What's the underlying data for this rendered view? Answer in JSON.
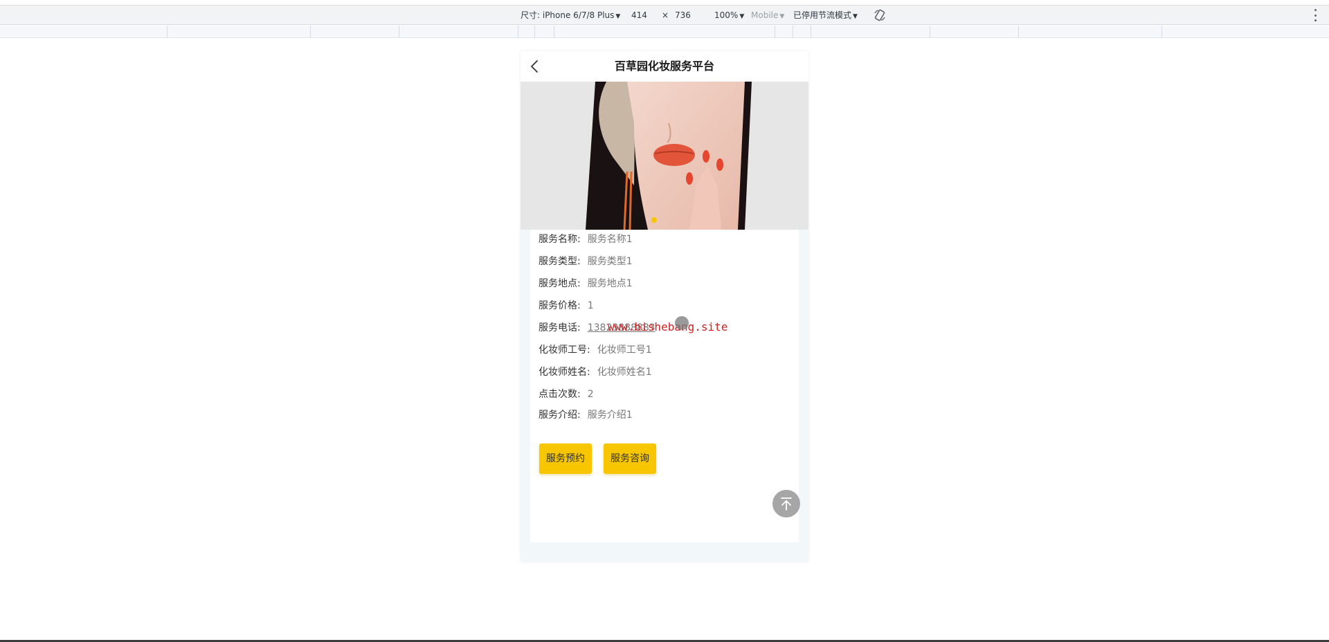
{
  "devtools": {
    "dimensions_label": "尺寸: iPhone 6/7/8 Plus",
    "width": "414",
    "times": "×",
    "height": "736",
    "zoom": "100%",
    "device_type": "Mobile",
    "throttle": "已停用节流模式"
  },
  "app": {
    "title": "百草园化妆服务平台"
  },
  "details": [
    {
      "label": "服务名称:",
      "value": "服务名称1"
    },
    {
      "label": "服务类型:",
      "value": "服务类型1"
    },
    {
      "label": "服务地点:",
      "value": "服务地点1"
    },
    {
      "label": "服务价格:",
      "value": "1"
    },
    {
      "label": "服务电话:",
      "value": "13823888883"
    },
    {
      "label": "化妆师工号:",
      "value": "化妆师工号1"
    },
    {
      "label": "化妆师姓名:",
      "value": "化妆师姓名1"
    },
    {
      "label": "点击次数:",
      "value": "2"
    },
    {
      "label": "服务介绍:",
      "value": "服务介绍1"
    }
  ],
  "actions": {
    "book_label": "服务预约",
    "consult_label": "服务咨询"
  },
  "watermark": "www.bishebang.site",
  "colors": {
    "accent": "#f7c600",
    "page_bg": "#f2f7f9"
  },
  "icons": {
    "back": "chevron-left-icon",
    "back_to_top": "arrow-up-to-line-icon",
    "rotate": "rotate-device-icon",
    "more": "kebab-menu-icon"
  }
}
